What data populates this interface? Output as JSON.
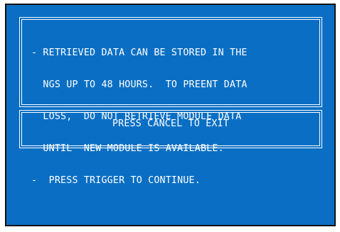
{
  "message": {
    "lines": [
      "- RETRIEVED DATA CAN BE STORED IN THE",
      "  NGS UP TO 48 HOURS.  TO PREENT DATA",
      "  LOSS,  DO NOT RETRIEVE MODULE DATA",
      "  UNTIL  NEW MODULE IS AVAILABLE.",
      "-  PRESS TRIGGER TO CONTINUE."
    ]
  },
  "exit_prompt": {
    "label": "PRESS CANCEL TO EXIT"
  },
  "colors": {
    "screen_background": "#0a6fc4",
    "text": "#ffffff",
    "border": "#ffffff"
  }
}
